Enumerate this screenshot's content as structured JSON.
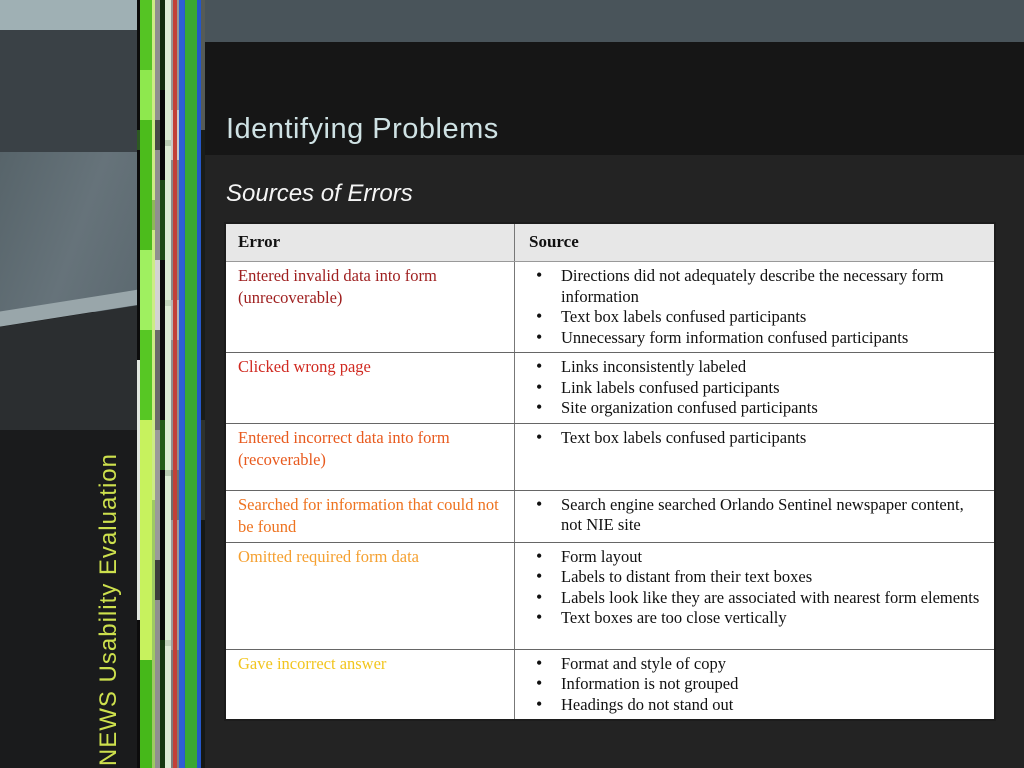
{
  "slide": {
    "title": "Identifying Problems",
    "subtitle": "Sources of Errors",
    "sidebar_text": "NEWS Usability Evaluation"
  },
  "colors": {
    "title_accent": "#cfe2e4",
    "subtitle_text": "#f5f5f5",
    "sidebar_text": "#cde04d",
    "table_header_bg": "#e7e7e7",
    "severity_scale": [
      "#9e1e1e",
      "#d02920",
      "#e85a1e",
      "#ee7320",
      "#f5a030",
      "#f2c51e"
    ]
  },
  "table": {
    "headers": [
      "Error",
      "Source"
    ],
    "rows": [
      {
        "error": "Entered invalid data into form (unrecoverable)",
        "color": "#9e1e1e",
        "sources": [
          "Directions did not adequately describe the necessary form information",
          "Text box labels confused participants",
          "Unnecessary form information confused participants"
        ]
      },
      {
        "error": "Clicked wrong page",
        "color": "#d02920",
        "sources": [
          "Links inconsistently labeled",
          "Link labels confused participants",
          "Site organization confused participants"
        ]
      },
      {
        "error": "Entered incorrect data into form (recoverable)",
        "color": "#e85a1e",
        "sources": [
          "Text box labels confused participants"
        ]
      },
      {
        "error": "Searched for information that could not be found",
        "color": "#ee7320",
        "sources": [
          "Search engine searched Orlando Sentinel newspaper content, not NIE site"
        ]
      },
      {
        "error": "Omitted required form data",
        "color": "#f5a030",
        "sources": [
          "Form layout",
          "Labels to distant from their text boxes",
          "Labels look like they are associated with nearest form elements",
          "Text boxes are too close vertically"
        ]
      },
      {
        "error": "Gave incorrect answer",
        "color": "#f2c51e",
        "sources": [
          "Format and style of copy",
          "Information is not grouped",
          "Headings do not stand out"
        ]
      }
    ]
  }
}
